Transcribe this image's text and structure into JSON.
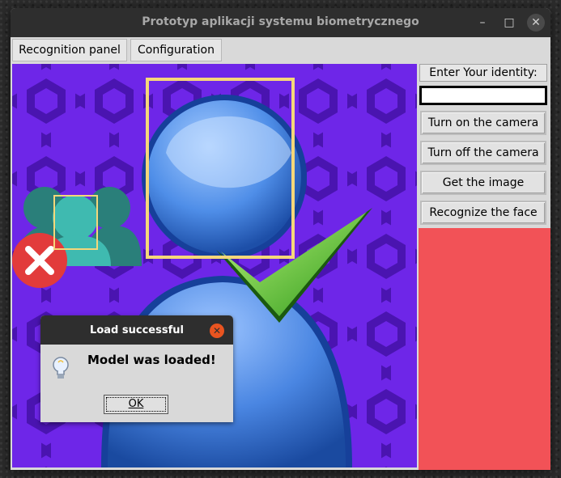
{
  "window": {
    "title": "Prototyp aplikacji systemu biometrycznego",
    "controls": {
      "minimize": "–",
      "maximize": "□",
      "close": "✕"
    }
  },
  "tabs": [
    {
      "label": "Recognition panel"
    },
    {
      "label": "Configuration"
    }
  ],
  "panel": {
    "identity_label": "Enter Your identity:",
    "identity_value": "",
    "buttons": {
      "camera_on": "Turn on the camera",
      "camera_off": "Turn off the camera",
      "get_image": "Get the image",
      "recognize": "Recognize the face"
    },
    "status_color": "#f25257"
  },
  "dialog": {
    "title": "Load successful",
    "message": "Model was loaded!",
    "ok_label": "OK",
    "close": "✕"
  },
  "colors": {
    "detection_box": "#f5d77a",
    "viewer_background": "#4a14b0",
    "titlebar": "#2e2e2e"
  }
}
